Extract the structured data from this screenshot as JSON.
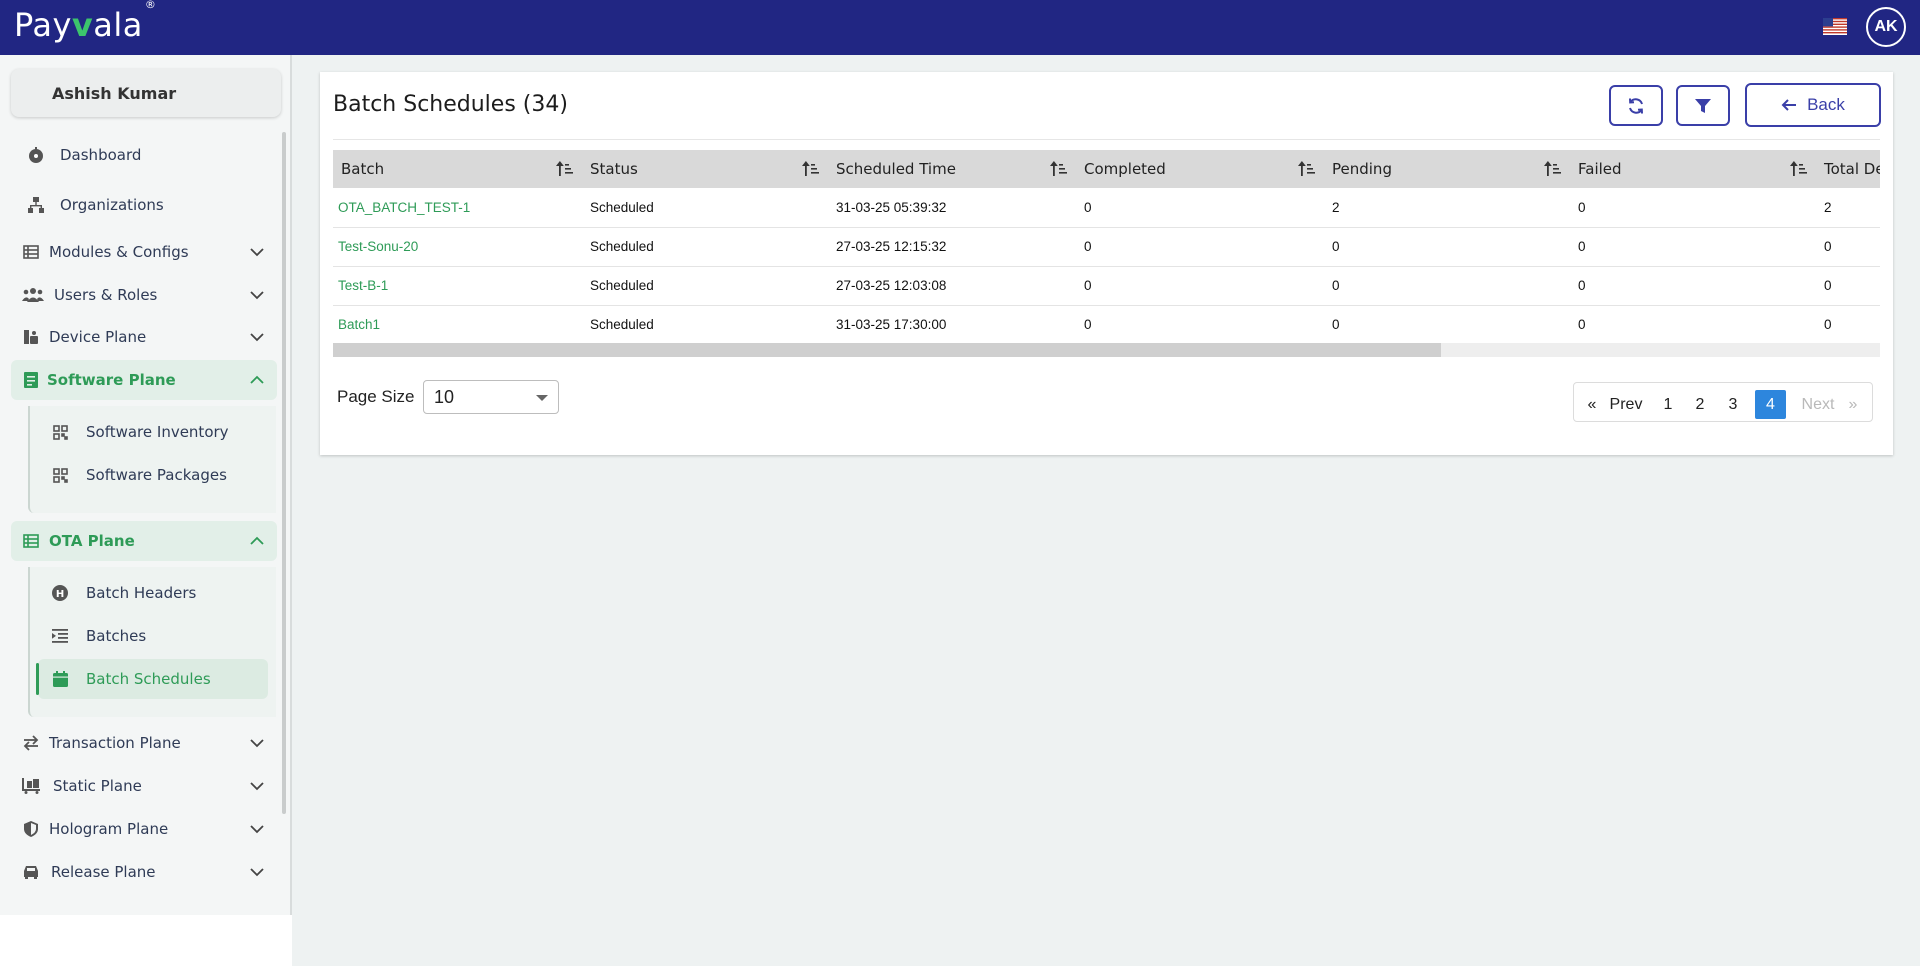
{
  "app": {
    "logo_text_pre": "Pay",
    "logo_text_v": "v",
    "logo_text_post": "ala",
    "logo_mark": "®",
    "avatar_initials": "AK",
    "flag_icon": "us-flag-icon",
    "colors": {
      "topbar": "#212683",
      "accent_green": "#2e9b57",
      "primary": "#3a3fa8",
      "page_active": "#2d86dd"
    }
  },
  "sidebar": {
    "user_name": "Ashish Kumar",
    "items": [
      {
        "label": "Dashboard",
        "icon": "dashboard-icon"
      },
      {
        "label": "Organizations",
        "icon": "org-chart-icon"
      },
      {
        "label": "Modules & Configs",
        "icon": "table-icon"
      },
      {
        "label": "Users & Roles",
        "icon": "users-icon"
      },
      {
        "label": "Device Plane",
        "icon": "device-icon"
      },
      {
        "label": "Software Plane",
        "icon": "document-icon"
      },
      {
        "label": "OTA Plane",
        "icon": "table-icon"
      },
      {
        "label": "Transaction Plane",
        "icon": "swap-icon"
      },
      {
        "label": "Static Plane",
        "icon": "dolly-icon"
      },
      {
        "label": "Hologram Plane",
        "icon": "shield-icon"
      },
      {
        "label": "Release Plane",
        "icon": "car-icon"
      }
    ],
    "software_sub": [
      {
        "label": "Software Inventory",
        "icon": "qr-grid-icon"
      },
      {
        "label": "Software Packages",
        "icon": "qr-grid-icon"
      }
    ],
    "ota_sub": [
      {
        "label": "Batch Headers",
        "icon": "h-circle-icon"
      },
      {
        "label": "Batches",
        "icon": "indent-list-icon"
      },
      {
        "label": "Batch Schedules",
        "icon": "calendar-icon"
      }
    ]
  },
  "main": {
    "title": "Batch Schedules (34)",
    "back_label": "Back",
    "columns": [
      "Batch",
      "Status",
      "Scheduled Time",
      "Completed",
      "Pending",
      "Failed",
      "Total De"
    ],
    "rows": [
      [
        "OTA_BATCH_TEST-1",
        "Scheduled",
        "31-03-25 05:39:32",
        "0",
        "2",
        "0",
        "2"
      ],
      [
        "Test-Sonu-20",
        "Scheduled",
        "27-03-25 12:15:32",
        "0",
        "0",
        "0",
        "0"
      ],
      [
        "Test-B-1",
        "Scheduled",
        "27-03-25 12:03:08",
        "0",
        "0",
        "0",
        "0"
      ],
      [
        "Batch1",
        "Scheduled",
        "31-03-25 17:30:00",
        "0",
        "0",
        "0",
        "0"
      ]
    ],
    "page_size_label": "Page Size",
    "page_size_value": "10",
    "pagination": {
      "first": "«",
      "prev": "Prev",
      "pages": [
        "1",
        "2",
        "3",
        "4"
      ],
      "current": "4",
      "next": "Next",
      "last": "»"
    }
  }
}
